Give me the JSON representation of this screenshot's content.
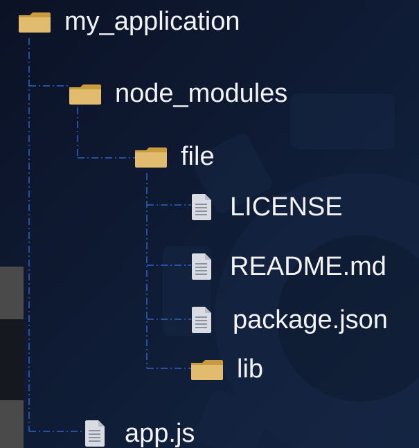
{
  "tree": {
    "root": {
      "label": "my_application",
      "icon": "folder-icon"
    },
    "node_modules": {
      "label": "node_modules",
      "icon": "folder-icon"
    },
    "file": {
      "label": "file",
      "icon": "folder-icon"
    },
    "license": {
      "label": "LICENSE",
      "icon": "document-icon"
    },
    "readme": {
      "label": "README.md",
      "icon": "document-icon"
    },
    "package_json": {
      "label": "package.json",
      "icon": "document-icon"
    },
    "lib": {
      "label": "lib",
      "icon": "folder-icon"
    },
    "app_js": {
      "label": "app.js",
      "icon": "document-icon"
    }
  },
  "colors": {
    "background": "#0f172d",
    "gear_overlay": "#162643",
    "connector": "#2d63c4",
    "text": "#f2f4f8",
    "folder": "#d8b05c",
    "document": "#d9dde3"
  }
}
